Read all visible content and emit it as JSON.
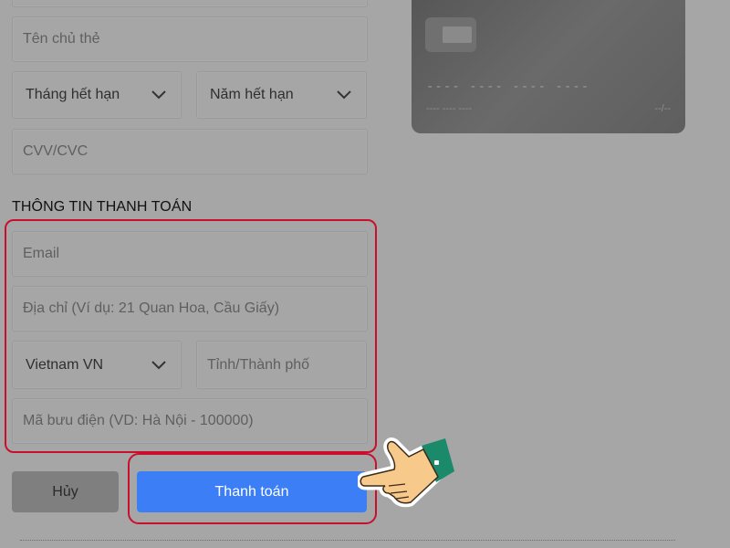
{
  "card_form": {
    "holder_placeholder": "Tên chủ thẻ",
    "expiry_month": "Tháng hết hạn",
    "expiry_year": "Năm hết hạn",
    "cvv_placeholder": "CVV/CVC"
  },
  "card_preview": {
    "number_placeholder": "---- ---- ----  ----",
    "name_placeholder": "---- ---- ----",
    "expiry_placeholder": "--/--"
  },
  "billing": {
    "section_title": "THÔNG TIN THANH TOÁN",
    "email_placeholder": "Email",
    "address_placeholder": "Địa chỉ (Ví dụ: 21 Quan Hoa, Cầu Giấy)",
    "country": "Vietnam VN",
    "city_placeholder": "Tỉnh/Thành phố",
    "postal_placeholder": "Mã bưu điện (VD: Hà Nội - 100000)"
  },
  "actions": {
    "cancel_label": "Hủy",
    "pay_label": "Thanh toán"
  },
  "colors": {
    "highlight": "#c8102e",
    "pay_button": "#3b7ef6"
  }
}
